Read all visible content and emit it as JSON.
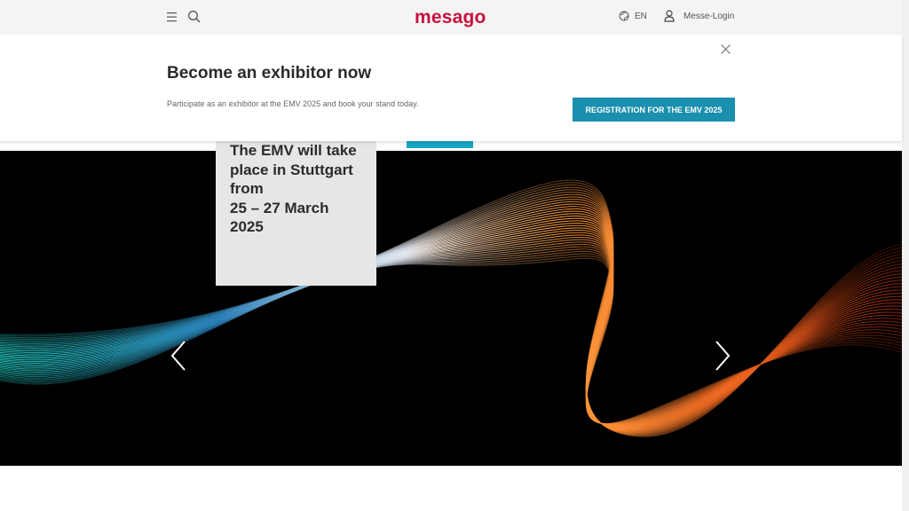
{
  "header": {
    "logo_text": "mesago",
    "menu_icon": "hamburger-menu-icon",
    "search_icon": "search-icon",
    "language_label": "EN",
    "language_icon": "globe-icon",
    "login_label": "Messe-Login",
    "login_icon": "user-icon",
    "logo_color": "#c8103e"
  },
  "banner": {
    "title": "Become an exhibitor now",
    "text": "Participate as an exhibitor at the EMV 2025 and book your stand today.",
    "cta_label": "REGISTRATION FOR THE EMV 2025",
    "cta_color": "#1a8fae",
    "close_icon": "close-icon"
  },
  "hero": {
    "card_lines": [
      "The EMV will take",
      "place in Stuttgart",
      "from",
      "25 – 27 March",
      "2025"
    ],
    "prev_icon": "chevron-left-icon",
    "next_icon": "chevron-right-icon"
  }
}
